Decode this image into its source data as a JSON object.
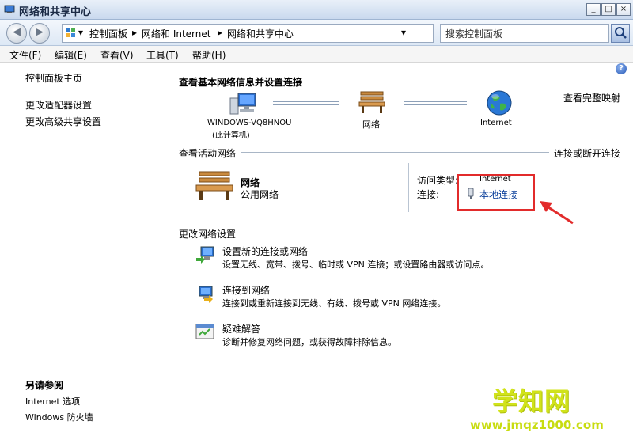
{
  "window": {
    "title": "网络和共享中心",
    "buttons": [
      "_",
      "□",
      "×"
    ]
  },
  "address": {
    "breadcrumbs": [
      "控制面板",
      "网络和 Internet",
      "网络和共享中心"
    ],
    "search_placeholder": "搜索控制面板"
  },
  "menu": [
    "文件(F)",
    "编辑(E)",
    "查看(V)",
    "工具(T)",
    "帮助(H)"
  ],
  "sidebar": {
    "home": "控制面板主页",
    "links": [
      "更改适配器设置",
      "更改高级共享设置"
    ],
    "see_also_title": "另请参阅",
    "see_also": [
      "Internet 选项",
      "Windows 防火墙"
    ]
  },
  "main": {
    "title": "查看基本网络信息并设置连接",
    "view_full_map": "查看完整映射",
    "map": {
      "computer_name": "WINDOWS-VQ8HNOU",
      "computer_sub": "(此计算机)",
      "network": "网络",
      "internet": "Internet"
    },
    "active_title": "查看活动网络",
    "connect_disconnect": "连接或断开连接",
    "active": {
      "name": "网络",
      "type": "公用网络",
      "access_label": "访问类型:",
      "access_value": "Internet",
      "conn_label": "连接:",
      "conn_value": "本地连接"
    },
    "change_title": "更改网络设置",
    "tasks": [
      {
        "title": "设置新的连接或网络",
        "desc": "设置无线、宽带、拨号、临时或 VPN 连接；或设置路由器或访问点。"
      },
      {
        "title": "连接到网络",
        "desc": "连接到或重新连接到无线、有线、拨号或 VPN 网络连接。"
      },
      {
        "title": "疑难解答",
        "desc": "诊断并修复网络问题，或获得故障排除信息。"
      }
    ]
  },
  "watermark": {
    "title": "学知网",
    "url": "www.jmqz1000.com"
  },
  "colors": {
    "annotation": "#e22b2b",
    "watermark": "#d1e31a"
  }
}
